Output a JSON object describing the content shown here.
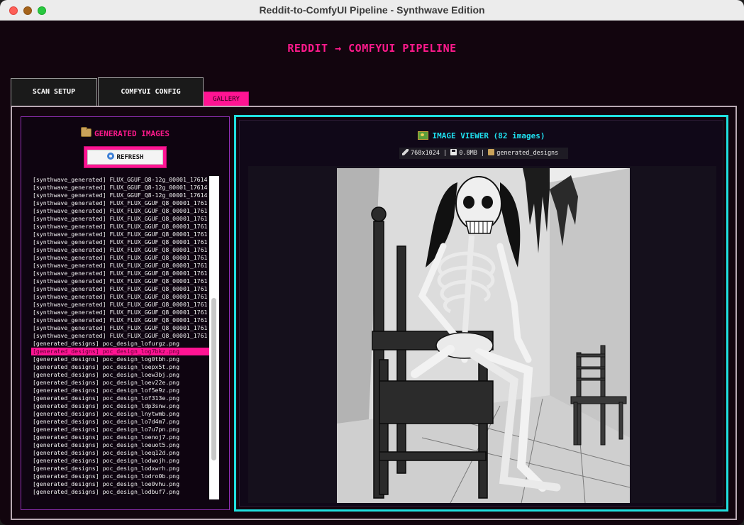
{
  "window": {
    "title": "Reddit-to-ComfyUI Pipeline - Synthwave Edition"
  },
  "app": {
    "title": "REDDIT → COMFYUI PIPELINE"
  },
  "tabs": [
    {
      "label": "SCAN SETUP",
      "active": false
    },
    {
      "label": "COMFYUI CONFIG",
      "active": false
    },
    {
      "label": "GALLERY",
      "active": true
    }
  ],
  "gallery": {
    "header": "GENERATED IMAGES",
    "header_icon": "folder-icon",
    "refresh_label": "REFRESH",
    "refresh_icon": "refresh-icon",
    "selected_index": 22,
    "files": [
      "[synthwave_generated] FLUX_GGUF_Q8-12g_00001_17614",
      "[synthwave_generated] FLUX_GGUF_Q8-12g_00001_17614",
      "[synthwave_generated] FLUX_GGUF_Q8-12g_00001_17614",
      "[synthwave_generated] FLUX_FLUX_GGUF_Q8_00001_1761",
      "[synthwave_generated] FLUX_FLUX_GGUF_Q8_00001_1761",
      "[synthwave_generated] FLUX_FLUX_GGUF_Q8_00001_1761",
      "[synthwave_generated] FLUX_FLUX_GGUF_Q8_00001_1761",
      "[synthwave_generated] FLUX_FLUX_GGUF_Q8_00001_1761",
      "[synthwave_generated] FLUX_FLUX_GGUF_Q8_00001_1761",
      "[synthwave_generated] FLUX_FLUX_GGUF_Q8_00001_1761",
      "[synthwave_generated] FLUX_FLUX_GGUF_Q8_00001_1761",
      "[synthwave_generated] FLUX_FLUX_GGUF_Q8_00001_1761",
      "[synthwave_generated] FLUX_FLUX_GGUF_Q8_00001_1761",
      "[synthwave_generated] FLUX_FLUX_GGUF_Q8_00001_1761",
      "[synthwave_generated] FLUX_FLUX_GGUF_Q8_00001_1761",
      "[synthwave_generated] FLUX_FLUX_GGUF_Q8_00001_1761",
      "[synthwave_generated] FLUX_FLUX_GGUF_Q8_00001_1761",
      "[synthwave_generated] FLUX_FLUX_GGUF_Q8_00001_1761",
      "[synthwave_generated] FLUX_FLUX_GGUF_Q8_00001_1761",
      "[synthwave_generated] FLUX_FLUX_GGUF_Q8_00001_1761",
      "[synthwave_generated] FLUX_FLUX_GGUF_Q8_00001_1761",
      "[generated_designs] poc_design_lofurgz.png",
      "[generated_designs] poc_design_log7bkz.png",
      "[generated_designs] poc_design_log0tbh.png",
      "[generated_designs] poc_design_loepx5t.png",
      "[generated_designs] poc_design_loew3bj.png",
      "[generated_designs] poc_design_loev22e.png",
      "[generated_designs] poc_design_lof5e9z.png",
      "[generated_designs] poc_design_lof313e.png",
      "[generated_designs] poc_design_ldp3snw.png",
      "[generated_designs] poc_design_lnytwmb.png",
      "[generated_designs] poc_design_lo7d4m7.png",
      "[generated_designs] poc_design_lo7u7pn.png",
      "[generated_designs] poc_design_loenoj7.png",
      "[generated_designs] poc_design_loeuot5.png",
      "[generated_designs] poc_design_loeq12d.png",
      "[generated_designs] poc_design_lodwojh.png",
      "[generated_designs] poc_design_lodxwrh.png",
      "[generated_designs] poc_design_lodro0b.png",
      "[generated_designs] poc_design_loe0vhu.png",
      "[generated_designs] poc_design_lodbuf7.png"
    ]
  },
  "viewer": {
    "title": "IMAGE VIEWER (82 images)",
    "title_icon": "picture-icon",
    "dimensions": "768x1024",
    "size": "0.8MB",
    "folder": "generated_designs",
    "sep": "|",
    "image_alt": "skeleton-on-chair-illustration"
  },
  "colors": {
    "accent_pink": "#ff1493",
    "accent_cyan": "#1fe0e0",
    "panel_purple": "#8f2fb4",
    "background": "#12050e"
  }
}
